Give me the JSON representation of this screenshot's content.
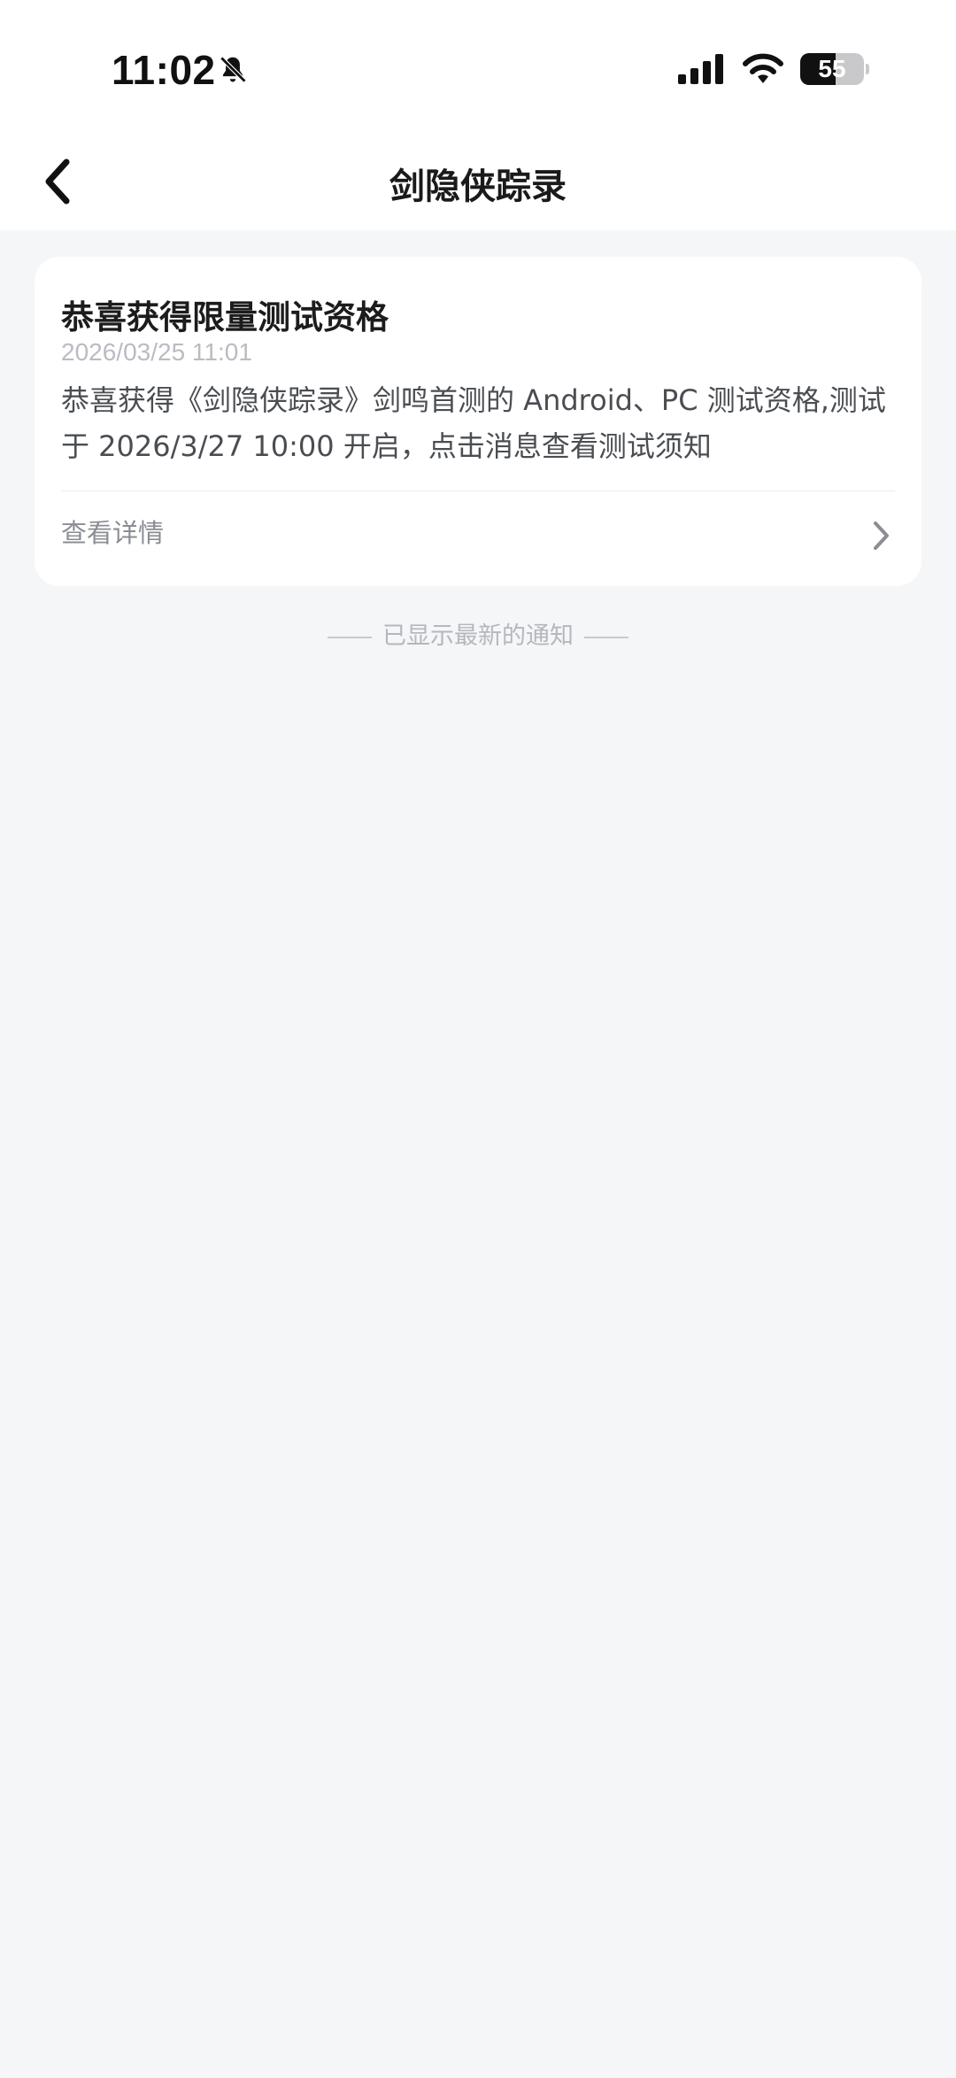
{
  "status_bar": {
    "time": "11:02",
    "battery": "55",
    "battery_level": 0.55,
    "icons": [
      "bell-mute-icon",
      "signal-icon",
      "wifi-icon",
      "battery-icon"
    ]
  },
  "nav": {
    "title": "剑隐侠踪录",
    "back_icon": "chevron-left-icon"
  },
  "notification": {
    "title": "恭喜获得限量测试资格",
    "time": "2026/03/25 11:01",
    "body": "恭喜获得《剑隐侠踪录》剑鸣首测的 Android、PC 测试资格,测试于 2026/3/27 10:00 开启，点击消息查看测试须知",
    "link_label": "查看详情",
    "link_icon": "chevron-right-icon"
  },
  "footer": {
    "end_note": "已显示最新的通知"
  },
  "colors": {
    "background": "#f5f6f8",
    "card": "#ffffff",
    "muted_text": "#b4b7bd"
  }
}
